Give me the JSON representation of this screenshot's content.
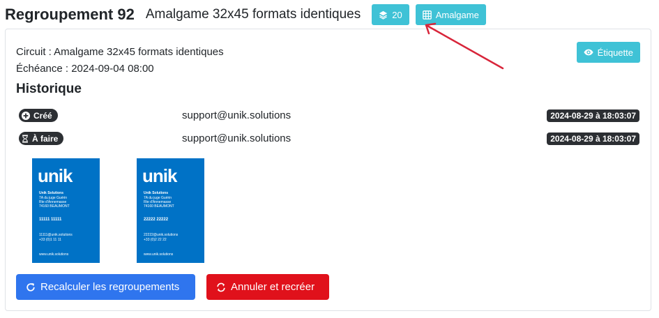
{
  "header": {
    "title": "Regroupement 92",
    "subtitle": "Amalgame 32x45 formats identiques",
    "count_badge": "20",
    "amalgame_badge": "Amalgame"
  },
  "card": {
    "circuit": "Circuit : Amalgame 32x45 formats identiques",
    "echeance": "Échéance : 2024-09-04 08:00",
    "etiquette_button": "Étiquette",
    "history_title": "Historique",
    "history": [
      {
        "status": "Créé",
        "user": "support@unik.solutions",
        "timestamp": "2024-08-29 à 18:03:07",
        "icon": "plus-circle-icon"
      },
      {
        "status": "À faire",
        "user": "support@unik.solutions",
        "timestamp": "2024-08-29 à 18:03:07",
        "icon": "hourglass-icon"
      }
    ],
    "cards": [
      {
        "logo": "unik",
        "company": "Unik Solutions",
        "address": [
          "7A du juge Guérin",
          "Rte d'Annemasse",
          "74160 BEAUMONT"
        ],
        "number": "11111 11111",
        "email": "11111@unik.solutions",
        "phone": "+33 (0)1 11 11",
        "web": "www.unik.solutions"
      },
      {
        "logo": "unik",
        "company": "Unik Solutions",
        "address": [
          "7A du juge Guérin",
          "Rte d'Annemasse",
          "74160 BEAUMONT"
        ],
        "number": "22222 22222",
        "email": "22222@unik.solutions",
        "phone": "+33 (0)2 22 22",
        "web": "www.unik.solutions"
      }
    ],
    "recalc_button": "Recalculer les regroupements",
    "cancel_button": "Annuler et recréer"
  },
  "colors": {
    "info": "#3fc2d6",
    "primary": "#2f75ee",
    "danger": "#e0111b",
    "dark_badge": "#2c2f33",
    "card_blue": "#0072c6",
    "annotation_arrow": "#d8253a"
  }
}
